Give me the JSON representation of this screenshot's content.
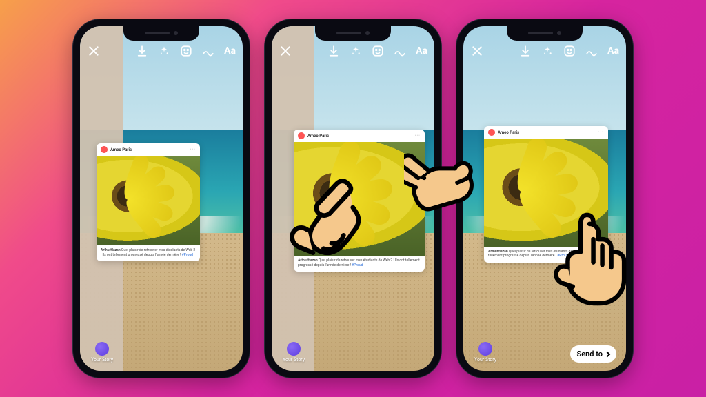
{
  "diagram": {
    "description": "Three-step Instagram Story editor illustration: left phone shows a shared post partially revealed behind a tan column; middle phone shows two hands performing a pinch/spread gesture to resize the post; right phone shows the post centered with a single-finger tap and the Send to button.",
    "steps": [
      "initial",
      "pinch-resize",
      "tap-send"
    ]
  },
  "toolbar": {
    "close_label": "Close",
    "download_label": "Download",
    "sparkle_label": "Effects",
    "sticker_label": "Stickers",
    "draw_label": "Draw",
    "text_label": "Aa"
  },
  "post": {
    "username": "Ameo Paris",
    "more": "···",
    "caption_author": "ArthurHazan",
    "caption_text": "Quel plaisir de retrouver mes étudiants de Web 2 ! Ils ont tellement progressé depuis l'année dernière !",
    "caption_hashtag": "#Proud"
  },
  "footer": {
    "your_story": "Your Story",
    "send_to": "Send to"
  },
  "gestures": {
    "middle": "pinch-spread",
    "right": "tap"
  },
  "colors": {
    "gradient_start": "#f7a04a",
    "gradient_end": "#c920a5",
    "sidepad": "#d2c2b0"
  }
}
